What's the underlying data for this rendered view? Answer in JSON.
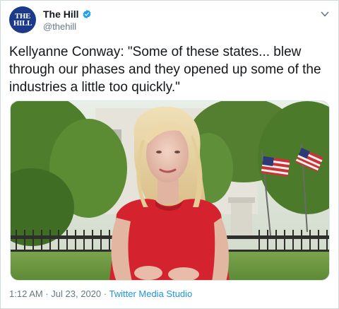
{
  "account": {
    "display_name": "The Hill",
    "handle": "@thehill",
    "avatar_line1": "THE",
    "avatar_line2": "HILL"
  },
  "tweet": {
    "text": "Kellyanne Conway: \"Some of these states... blew through our phases and they opened up some of the industries a little too quickly.\"",
    "time": "1:12 AM",
    "separator1": "·",
    "date": "Jul 23, 2020",
    "separator2": "·",
    "source": "Twitter Media Studio"
  },
  "colors": {
    "avatar_bg": "#1c3a8a",
    "verified_blue": "#1da1f2",
    "link_blue": "#1b95e0",
    "muted_gray": "#657786"
  },
  "icons": {
    "verified": "verified-badge-icon",
    "menu": "chevron-down-icon"
  }
}
